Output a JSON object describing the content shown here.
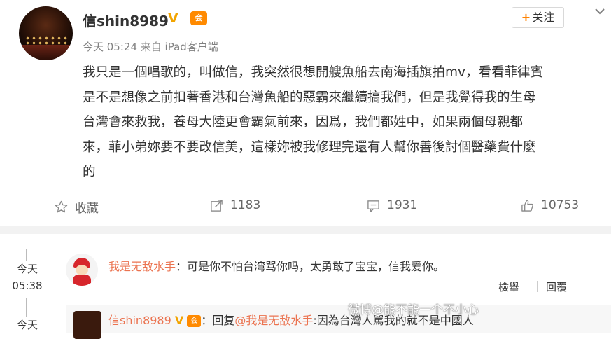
{
  "post": {
    "username": "信shin8989",
    "meta": "今天 05:24 来自 iPad客户端",
    "follow_label": "关注",
    "content": [
      "我只是一個唱歌的，叫做信，我突然很想開艘魚船去南海插旗拍mv，看看菲律賓",
      "是不是想像之前扣著香港和台灣魚船的惡霸來繼續搞我們，但是我覺得我的生母",
      "台灣會來救我，養母大陸更會霸氣前來，因爲，我們都姓中，如果兩個母親都",
      "來，菲小弟妳要不要改信美，這樣妳被我修理完還有人幫你善後討個醫藥費什麼",
      "的"
    ]
  },
  "actions": {
    "favorite": "收藏",
    "repost": "1183",
    "comment": "1931",
    "like": "10753"
  },
  "comments": [
    {
      "time_day": "今天",
      "time_clock": "05:38",
      "name": "我是无敌水手",
      "text": "：可是你不怕台湾骂你吗，太勇敢了宝宝，信我爱你。",
      "report": "檢舉",
      "reply": "回覆"
    },
    {
      "time_day": "今天",
      "name": "信shin8989",
      "reply_prefix": "：回复",
      "mention": "@我是无敌水手",
      "text": ":因為台灣人罵我的就不是中國人"
    }
  ],
  "watermark": "微博@能不能一个不小心"
}
